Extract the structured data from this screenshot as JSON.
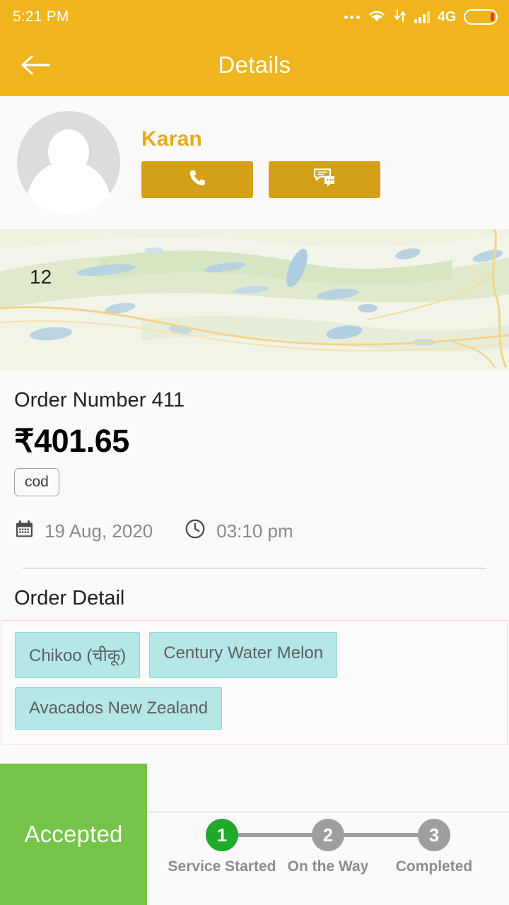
{
  "statusbar": {
    "time": "5:21 PM",
    "network_label": "4G",
    "icons": [
      "more-dots-icon",
      "wifi-icon",
      "data-transfer-icon",
      "signal-bars-icon",
      "battery-icon"
    ]
  },
  "appbar": {
    "title": "Details",
    "back_icon": "back-arrow-icon"
  },
  "contact": {
    "name": "Karan",
    "avatar_icon": "person-placeholder-icon",
    "call_icon": "phone-icon",
    "chat_icon": "chat-bubble-icon"
  },
  "map": {
    "label": "12"
  },
  "order": {
    "number_text": "Order Number 411",
    "price": "₹401.65",
    "payment_badge": "cod",
    "date": "19 Aug, 2020",
    "time": "03:10 pm",
    "calendar_icon": "calendar-icon",
    "clock_icon": "clock-icon"
  },
  "order_detail": {
    "heading": "Order Detail",
    "items": [
      "Chikoo (चीकू)",
      "Century Water Melon",
      "Avacados New Zealand"
    ]
  },
  "bottom": {
    "status_label": "Accepted",
    "steps": [
      {
        "number": "1",
        "label": "Service Started",
        "state": "active"
      },
      {
        "number": "2",
        "label": "On the Way",
        "state": "inactive"
      },
      {
        "number": "3",
        "label": "Completed",
        "state": "inactive"
      }
    ]
  },
  "colors": {
    "brand_yellow": "#f0b41c",
    "action_gold": "#d4a017",
    "name_amber": "#eaa81c",
    "accepted_green": "#76c44a",
    "step_active_green": "#1faa29",
    "step_inactive_gray": "#9e9e9e",
    "chip_cyan": "#b4e7e6",
    "chip_border": "#8ed8d6",
    "detail_border_pink": "#fadada"
  }
}
